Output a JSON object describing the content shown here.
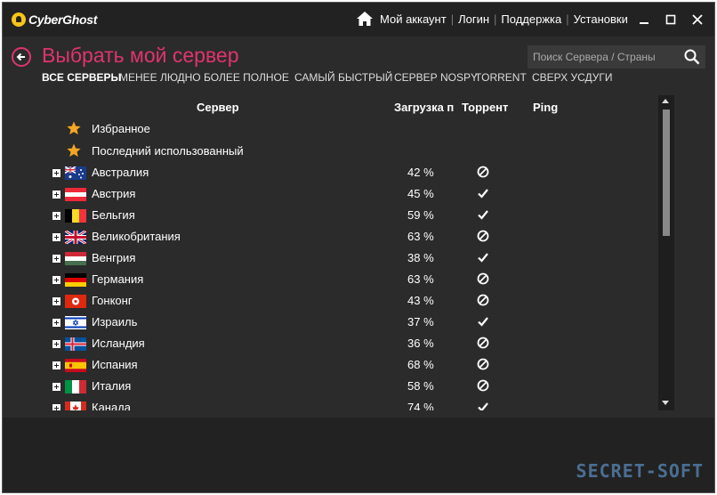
{
  "app": {
    "logo_text": "CyberGhost"
  },
  "topnav": {
    "account": "Мой аккаунт",
    "login": "Логин",
    "support": "Поддержка",
    "settings": "Установки"
  },
  "header": {
    "title": "Выбрать мой сервер",
    "search_placeholder": "Поиск Сервера / Страны"
  },
  "tabs": [
    "ВСЕ СЕРВЕРЫ",
    "МЕНЕЕ ЛЮДНО",
    "БОЛЕЕ ПОЛНОЕ",
    "САМЫЙ БЫСТРЫЙ",
    "СЕРВЕР NOSPY",
    "TORRENT",
    "СВЕРХ УСДУГИ"
  ],
  "columns": {
    "server": "Сервер",
    "load": "Загрузка п",
    "torrent": "Торрент",
    "ping": "Ping"
  },
  "favorites": [
    "Избранное",
    "Последний использованный"
  ],
  "servers": [
    {
      "name": "Австралия",
      "load": "42 %",
      "torrent": "no",
      "flag": "au"
    },
    {
      "name": "Австрия",
      "load": "45 %",
      "torrent": "yes",
      "flag": "at"
    },
    {
      "name": "Бельгия",
      "load": "59 %",
      "torrent": "yes",
      "flag": "be"
    },
    {
      "name": "Великобритания",
      "load": "63 %",
      "torrent": "no",
      "flag": "gb"
    },
    {
      "name": "Венгрия",
      "load": "38 %",
      "torrent": "yes",
      "flag": "hu"
    },
    {
      "name": "Германия",
      "load": "63 %",
      "torrent": "no",
      "flag": "de"
    },
    {
      "name": "Гонконг",
      "load": "43 %",
      "torrent": "no",
      "flag": "hk"
    },
    {
      "name": "Израиль",
      "load": "37 %",
      "torrent": "yes",
      "flag": "il"
    },
    {
      "name": "Исландия",
      "load": "36 %",
      "torrent": "no",
      "flag": "is"
    },
    {
      "name": "Испания",
      "load": "68 %",
      "torrent": "no",
      "flag": "es"
    },
    {
      "name": "Италия",
      "load": "58 %",
      "torrent": "no",
      "flag": "it"
    },
    {
      "name": "Канада",
      "load": "74 %",
      "torrent": "yes",
      "flag": "ca"
    }
  ],
  "watermark": "SECRET-SOFT",
  "colors": {
    "accent": "#e0346d",
    "star": "#f5a623",
    "logo": "#f5c518"
  }
}
